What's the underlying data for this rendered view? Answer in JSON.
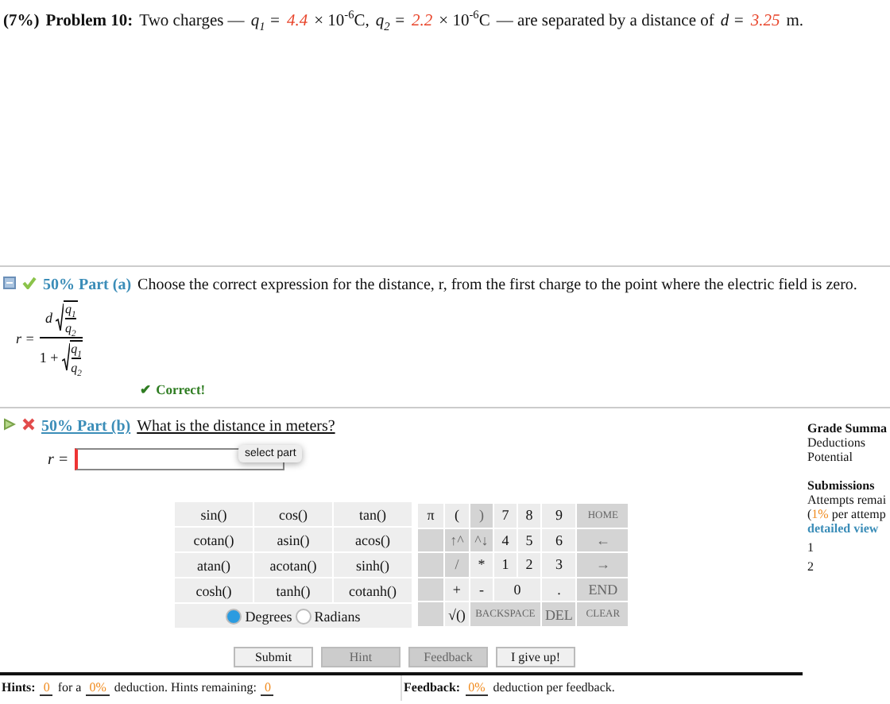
{
  "problem": {
    "weight": "(7%)",
    "title": "Problem 10:",
    "text_1": "Two charges —",
    "q1_label": "q$_{1}$ =",
    "q1_value": "4.4",
    "q1_unit": "× 10$^{-6}$C,",
    "q2_label": "q$_{2}$ =",
    "q2_value": "2.2",
    "q2_unit": "× 10$^{-6}$C",
    "text_2": "— are separated by a distance of",
    "d_label": "d =",
    "d_value": "3.25",
    "d_unit": "m."
  },
  "part_a": {
    "correct": true,
    "expanded": true,
    "percent": "50%",
    "label": "Part (a)",
    "question": "Choose the correct expression for the distance, r, from the first charge to the point where the electric field is zero.",
    "formula": {
      "lhs": "r =",
      "num_factor": "d",
      "num_top": "q$_{1}$",
      "num_bottom": "q$_{2}$",
      "den_lead": "1 +",
      "den_top": "q$_{1}$",
      "den_bottom": "q$_{2}$"
    },
    "feedback": "✔ Correct!"
  },
  "part_b": {
    "correct": false,
    "expanded": false,
    "percent": "50%",
    "label": "Part (b)",
    "question": "What is the distance in meters?",
    "answer_label": "r =",
    "tooltip": "select part"
  },
  "functions": [
    {
      "label": "sin()"
    },
    {
      "label": "cos()"
    },
    {
      "label": "tan()"
    },
    {
      "label": "cotan()"
    },
    {
      "label": "asin()"
    },
    {
      "label": "acos()"
    },
    {
      "label": "atan()"
    },
    {
      "label": "acotan()"
    },
    {
      "label": "sinh()"
    },
    {
      "label": "cosh()"
    },
    {
      "label": "tanh()"
    },
    {
      "label": "cotanh()"
    }
  ],
  "angle_modes": [
    {
      "label": "Degrees",
      "selected": true
    },
    {
      "label": "Radians",
      "selected": false
    }
  ],
  "keypad": [
    [
      {
        "kind": "key",
        "label": "π",
        "disabled": false
      },
      {
        "kind": "key",
        "label": "(",
        "disabled": false
      },
      {
        "kind": "key",
        "label": ")",
        "disabled": true
      },
      {
        "kind": "key",
        "label": "7",
        "disabled": false
      },
      {
        "kind": "key",
        "label": "8",
        "disabled": false
      },
      {
        "kind": "key",
        "label": "9",
        "disabled": false
      },
      {
        "kind": "key",
        "label": "HOME",
        "disabled": true
      }
    ],
    [
      {
        "kind": "blank"
      },
      {
        "kind": "key",
        "label": "↑^",
        "disabled": true
      },
      {
        "kind": "key",
        "label": "^↓",
        "disabled": true
      },
      {
        "kind": "key",
        "label": "4",
        "disabled": false
      },
      {
        "kind": "key",
        "label": "5",
        "disabled": false
      },
      {
        "kind": "key",
        "label": "6",
        "disabled": false
      },
      {
        "kind": "key",
        "label": "←",
        "disabled": true
      }
    ],
    [
      {
        "kind": "blank"
      },
      {
        "kind": "key",
        "label": "/",
        "disabled": true
      },
      {
        "kind": "key",
        "label": "*",
        "disabled": false
      },
      {
        "kind": "key",
        "label": "1",
        "disabled": false
      },
      {
        "kind": "key",
        "label": "2",
        "disabled": false
      },
      {
        "kind": "key",
        "label": "3",
        "disabled": false
      },
      {
        "kind": "key",
        "label": "→",
        "disabled": true
      }
    ],
    [
      {
        "kind": "blank"
      },
      {
        "kind": "key",
        "label": "+",
        "disabled": false
      },
      {
        "kind": "key",
        "label": "-",
        "disabled": false
      },
      {
        "kind": "wide2",
        "label": "0",
        "disabled": false
      },
      {
        "kind": "key",
        "label": ".",
        "disabled": false
      },
      {
        "kind": "key",
        "label": "END",
        "disabled": true
      }
    ],
    [
      {
        "kind": "blank"
      },
      {
        "kind": "key",
        "label": "√()",
        "disabled": false
      },
      {
        "kind": "wide3",
        "label": "BACKSPACE",
        "disabled": true
      },
      {
        "kind": "key",
        "label": "DEL",
        "disabled": true
      },
      {
        "kind": "key",
        "label": "CLEAR",
        "disabled": true
      }
    ]
  ],
  "actions": [
    {
      "label": "Submit",
      "disabled": false
    },
    {
      "label": "Hint",
      "disabled": true
    },
    {
      "label": "Feedback",
      "disabled": true
    },
    {
      "label": "I give up!",
      "disabled": false
    }
  ],
  "hints": {
    "title": "Hints:",
    "count": "0",
    "text_1": "for a",
    "deduction": "0%",
    "text_2": "deduction. Hints remaining:",
    "remaining": "0"
  },
  "feedback": {
    "title": "Feedback:",
    "deduction": "0%",
    "text": "deduction per feedback."
  },
  "sidebar": {
    "grade_title": "Grade Summa",
    "grade_rows": [
      "Deductions",
      "Potential"
    ],
    "submissions_title": "Submissions",
    "attempts": "Attempts remai",
    "per_attempt_open": "(",
    "per_attempt_value": "1%",
    "per_attempt_text": "per attemp",
    "detailed_link": "detailed view",
    "rows": [
      "1",
      "2"
    ]
  }
}
